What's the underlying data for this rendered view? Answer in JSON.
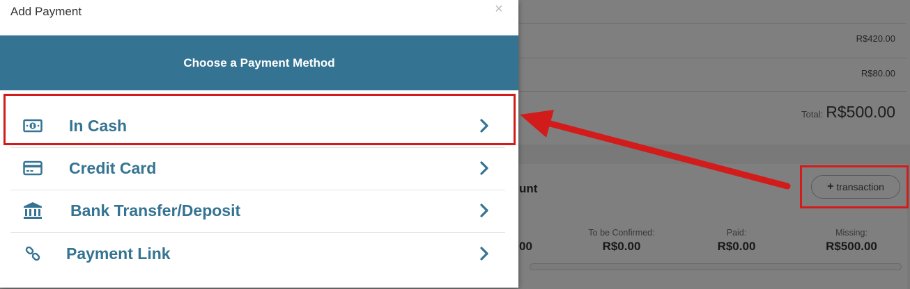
{
  "modal": {
    "title": "Add Payment",
    "close_label": "×",
    "banner": "Choose a Payment Method",
    "methods": [
      {
        "label": "In Cash",
        "icon": "cash-icon"
      },
      {
        "label": "Credit Card",
        "icon": "credit-card-icon"
      },
      {
        "label": "Bank Transfer/Deposit",
        "icon": "bank-icon"
      },
      {
        "label": "Payment Link",
        "icon": "link-icon"
      }
    ]
  },
  "background": {
    "line_amounts": [
      "R$420.00",
      "R$80.00"
    ],
    "total_label": "Total:",
    "total_value": "R$500.00",
    "section_title_partial": "unt",
    "transaction_button": "transaction",
    "partial_value": "00",
    "stats": [
      {
        "label": "To be Confirmed:",
        "value": "R$0.00"
      },
      {
        "label": "Paid:",
        "value": "R$0.00"
      },
      {
        "label": "Missing:",
        "value": "R$500.00"
      }
    ]
  },
  "colors": {
    "brand": "#347392",
    "highlight": "#d21c1c"
  }
}
